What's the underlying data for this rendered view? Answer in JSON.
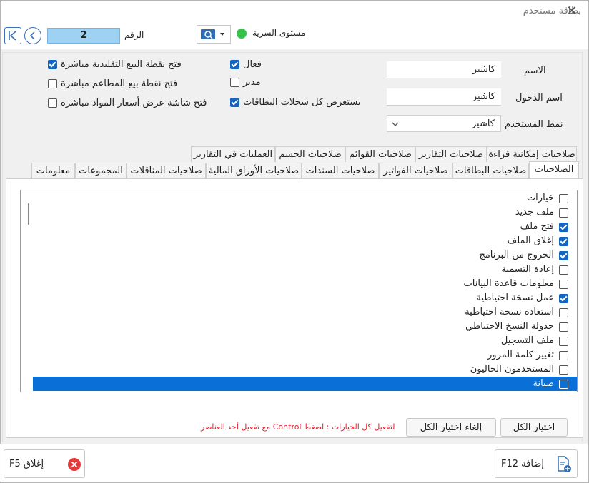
{
  "window": {
    "title": "بطاقة مستخدم"
  },
  "top": {
    "number_label": "الرقم",
    "number_value": "2",
    "security_label": "مستوى السرية",
    "security_color": "#35c24a"
  },
  "fields": {
    "name_label": "الاسم",
    "name_value": "كاشير",
    "login_label": "اسم الدخول",
    "login_value": "كاشير",
    "type_label": "نمط المستخدم",
    "type_value": "كاشير"
  },
  "options": {
    "active": {
      "label": "فعال",
      "checked": true
    },
    "manager": {
      "label": "مدير",
      "checked": false
    },
    "browse_all": {
      "label": "يستعرض كل سجلات البطاقات",
      "checked": true
    },
    "open_pos": {
      "label": "فتح نقطة البيع التقليدية مباشرة",
      "checked": true
    },
    "open_restaurant": {
      "label": "فتح نقطة بيع المطاعم مباشرة",
      "checked": false
    },
    "open_prices": {
      "label": "فتح شاشة عرض أسعار المواد مباشرة",
      "checked": false
    }
  },
  "tabs_row1": [
    "صلاحيات إمكانية قراءة",
    "صلاحيات التقارير",
    "صلاحيات القوائم",
    "صلاحيات الحسم",
    "العمليات في التقارير"
  ],
  "tabs_row2": [
    "الصلاحيات",
    "صلاحيات البطاقات",
    "صلاحيات الفواتير",
    "صلاحيات السندات",
    "صلاحيات الأوراق المالية",
    "صلاحيات المناقلات",
    "المجموعات",
    "معلومات"
  ],
  "permissions": [
    {
      "label": "خيارات",
      "checked": false
    },
    {
      "label": "ملف جديد",
      "checked": false
    },
    {
      "label": "فتح ملف",
      "checked": true
    },
    {
      "label": "إغلاق الملف",
      "checked": true
    },
    {
      "label": "الخروج من البرنامج",
      "checked": true
    },
    {
      "label": "إعادة التسمية",
      "checked": false
    },
    {
      "label": "معلومات قاعدة البيانات",
      "checked": false
    },
    {
      "label": "عمل نسخة احتياطية",
      "checked": true
    },
    {
      "label": "استعادة نسخة احتياطية",
      "checked": false
    },
    {
      "label": "جدولة النسخ الاحتياطي",
      "checked": false
    },
    {
      "label": "ملف التسجيل",
      "checked": false
    },
    {
      "label": "تغيير كلمة المرور",
      "checked": false
    },
    {
      "label": "المستخدمون الحاليون",
      "checked": false
    },
    {
      "label": "صيانة",
      "checked": false
    }
  ],
  "selected_permission": "صيانة",
  "actions": {
    "select_all": "اختيار الكل",
    "deselect_all": "إلغاء اختيار الكل",
    "hint": "لتفعيل كل الخيارات : اضغط Control مع تفعيل أحد العناصر"
  },
  "footer": {
    "add": "إضافة F12",
    "close": "إغلاق F5"
  }
}
